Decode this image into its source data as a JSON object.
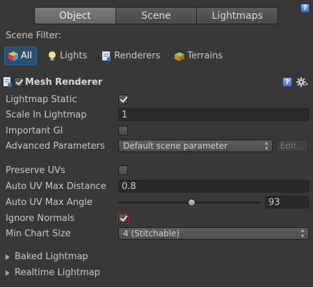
{
  "tabs": [
    {
      "label": "Object",
      "active": true
    },
    {
      "label": "Scene",
      "active": false
    },
    {
      "label": "Lightmaps",
      "active": false
    }
  ],
  "help_icon_glyph": "?",
  "scene_filter": {
    "label": "Scene Filter:",
    "buttons": [
      {
        "label": "All",
        "icon": "cube-icon",
        "active": true
      },
      {
        "label": "Lights",
        "icon": "bulb-icon",
        "active": false
      },
      {
        "label": "Renderers",
        "icon": "renderer-icon",
        "active": false
      },
      {
        "label": "Terrains",
        "icon": "terrain-icon",
        "active": false
      }
    ]
  },
  "component": {
    "title": "Mesh Renderer",
    "enabled": true,
    "gear_icon": "gear-icon"
  },
  "fields": {
    "lightmap_static": {
      "label": "Lightmap Static",
      "checked": true
    },
    "scale_in_lightmap": {
      "label": "Scale In Lightmap",
      "value": "1"
    },
    "important_gi": {
      "label": "Important GI",
      "checked": false
    },
    "advanced_parameters": {
      "label": "Advanced Parameters",
      "value": "Default scene parameter",
      "edit_label": "Edit..."
    },
    "preserve_uvs": {
      "label": "Preserve UVs",
      "checked": false
    },
    "auto_uv_max_distance": {
      "label": "Auto UV Max Distance",
      "value": "0.8"
    },
    "auto_uv_max_angle": {
      "label": "Auto UV Max Angle",
      "value": "93",
      "slider_fraction": 0.517
    },
    "ignore_normals": {
      "label": "Ignore Normals",
      "checked": true
    },
    "min_chart_size": {
      "label": "Min Chart Size",
      "value": "4 (Stitchable)"
    }
  },
  "foldouts": [
    {
      "label": "Baked Lightmap"
    },
    {
      "label": "Realtime Lightmap"
    }
  ],
  "colors": {
    "background": "#383838",
    "active_filter": "#2e4f70",
    "highlight_outline": "#c02020"
  }
}
